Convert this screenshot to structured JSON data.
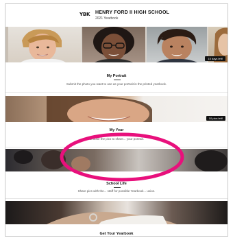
{
  "header": {
    "logo_text": "YBK",
    "school_name": "HENRY FORD II HIGH SCHOOL",
    "yearbook_label": "2021 Yearbook"
  },
  "cards": [
    {
      "title": "My Portrait",
      "description": "Submit the photo you want to use as your portrait in the printed yearbook.",
      "badge": "15 days left!"
    },
    {
      "title": "My Year",
      "description": "Choose the pics to share... your portrait.",
      "badge": "10 pics left!"
    },
    {
      "title": "School Life",
      "description": "Share pics with the... staff for possible Yearbook... usion."
    },
    {
      "title": "Get Your Yearbook"
    }
  ],
  "colors": {
    "annotation_ellipse": "#e8107c",
    "badge_bg": "#111111"
  }
}
